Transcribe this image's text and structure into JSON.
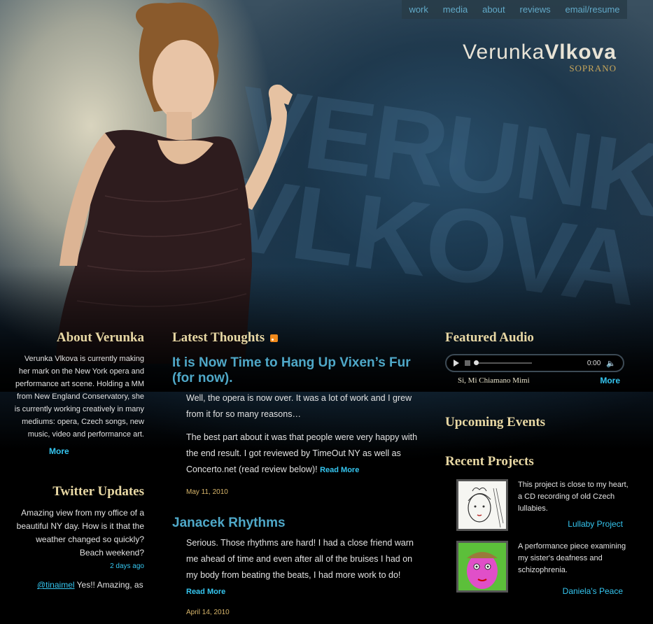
{
  "nav": {
    "items": [
      "work",
      "media",
      "about",
      "reviews",
      "email/resume"
    ]
  },
  "brand": {
    "first_name": "Verunka",
    "last_name": "Vlkova",
    "role": "SOPRANO",
    "wall_text": "VERUNKA VLKOVA"
  },
  "about": {
    "title": "About Verunka",
    "body": "Verunka Vlkova is currently making her mark on the New York opera and performance art scene. Holding a MM from New England Conservatory, she is currently working creatively in many mediums: opera, Czech songs, new music, video and performance art.",
    "more": "More"
  },
  "twitter": {
    "title": "Twitter Updates",
    "tweet1": "Amazing view from my office of a beautiful NY day. How is it that the weather changed so quickly? Beach weekend?",
    "tweet1_ago": "2 days ago",
    "tweet2_handle": "@tinaimel",
    "tweet2_text": " Yes!! Amazing, as"
  },
  "thoughts": {
    "title": "Latest Thoughts",
    "posts": [
      {
        "title": "It is Now Time to Hang Up Vixen’s Fur (for now).",
        "p1": "Well, the opera is now over. It was a lot of work and I grew from it for so many reasons…",
        "p2": "The best part about it was that people were very happy with the end result. I got reviewed by TimeOut NY as well as Concerto.net (read review below)!",
        "read_more": "Read More",
        "date": "May 11, 2010"
      },
      {
        "title": "Janacek Rhythms",
        "p1": "Serious. Those rhythms are hard! I had a close friend warn me ahead of time and even after all of the bruises I had on my body from beating the beats, I had more work to do!",
        "read_more": "Read More",
        "date": "April 14, 2010"
      }
    ]
  },
  "audio": {
    "title": "Featured Audio",
    "time": "0:00",
    "song": "Si, Mi Chiamano Mimi",
    "more": "More"
  },
  "events": {
    "title": "Upcoming Events"
  },
  "projects": {
    "title": "Recent Projects",
    "items": [
      {
        "text": "This project is close to my heart, a CD recording of old Czech lullabies.",
        "link": "Lullaby Project"
      },
      {
        "text": "A performance piece examining my sister's deafness and schizophrenia.",
        "link": "Daniela's Peace"
      }
    ]
  },
  "colors": {
    "accent": "#35c6f0",
    "heading": "#e8d8a4",
    "date": "#d7b56a",
    "nav": "#62a9c8"
  }
}
